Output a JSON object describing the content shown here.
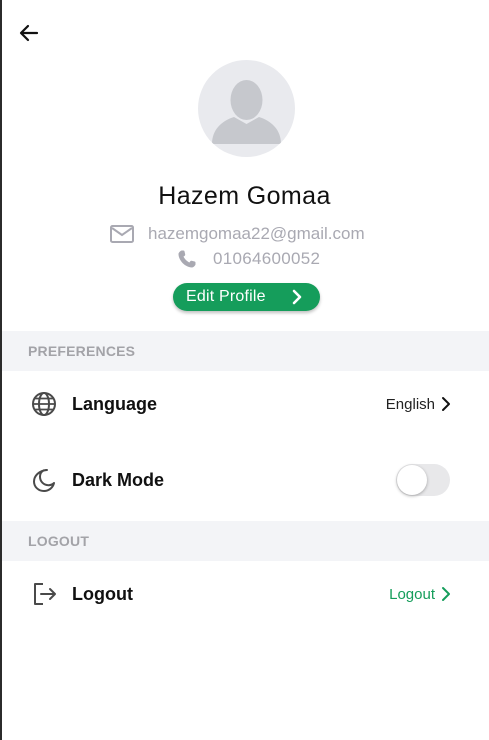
{
  "profile": {
    "name": "Hazem Gomaa",
    "email": "hazemgomaa22@gmail.com",
    "phone": "01064600052",
    "edit_label": "Edit Profile"
  },
  "sections": {
    "preferences": {
      "title": "PREFERENCES",
      "language": {
        "label": "Language",
        "value": "English",
        "icon": "globe-icon"
      },
      "dark_mode": {
        "label": "Dark Mode",
        "enabled": false,
        "icon": "moon-icon"
      }
    },
    "logout": {
      "title": "LOGOUT",
      "item": {
        "label": "Logout",
        "action_label": "Logout",
        "icon": "logout-icon"
      }
    }
  },
  "colors": {
    "accent": "#159d5b",
    "muted_text": "#a9a9b2",
    "section_bg": "#f3f4f7",
    "avatar_bg": "#e9eaee"
  }
}
